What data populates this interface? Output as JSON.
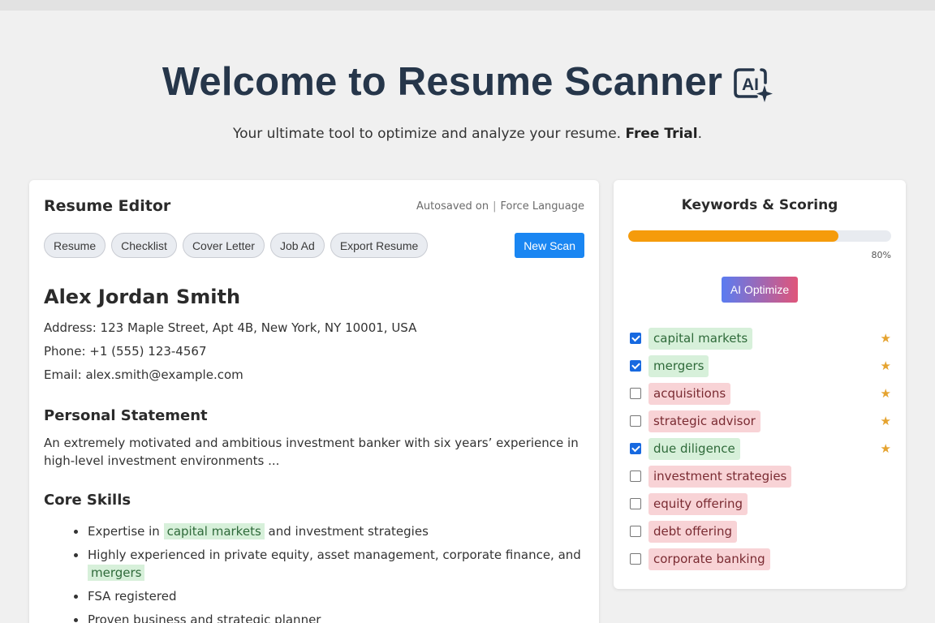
{
  "header": {
    "title": "Welcome to Resume Scanner",
    "subtitle_main": "Your ultimate tool to optimize and analyze your resume.",
    "subtitle_bold": "Free Trial",
    "subtitle_end": "."
  },
  "editor": {
    "title": "Resume Editor",
    "autosave": "Autosaved on",
    "force_language": "Force Language",
    "tabs": [
      "Resume",
      "Checklist",
      "Cover Letter",
      "Job Ad",
      "Export Resume"
    ],
    "new_scan_label": "New Scan",
    "resume": {
      "name": "Alex Jordan Smith",
      "address": "Address: 123 Maple Street, Apt 4B, New York, NY 10001, USA",
      "phone": "Phone: +1 (555) 123-4567",
      "email": "Email: alex.smith@example.com",
      "personal_statement_heading": "Personal Statement",
      "personal_statement": "An extremely motivated and ambitious investment banker with six years’ experience in high-level investment environments ...",
      "core_skills_heading": "Core Skills",
      "skills": [
        {
          "before": "Expertise in ",
          "keyword": "capital markets",
          "after": " and investment strategies"
        },
        {
          "before": "Highly experienced in private equity, asset management, corporate finance, and ",
          "keyword": "mergers",
          "after": ""
        },
        {
          "before": "FSA registered",
          "keyword": "",
          "after": ""
        },
        {
          "before": "Proven business and strategic planner",
          "keyword": "",
          "after": ""
        }
      ]
    }
  },
  "scoring": {
    "title": "Keywords & Scoring",
    "progress_percent": 80,
    "progress_text": "80%",
    "ai_optimize_label": "AI Optimize",
    "keywords": [
      {
        "label": "capital markets",
        "checked": true,
        "starred": true
      },
      {
        "label": "mergers",
        "checked": true,
        "starred": true
      },
      {
        "label": "acquisitions",
        "checked": false,
        "starred": true
      },
      {
        "label": "strategic advisor",
        "checked": false,
        "starred": true
      },
      {
        "label": "due diligence",
        "checked": true,
        "starred": true
      },
      {
        "label": "investment strategies",
        "checked": false,
        "starred": false
      },
      {
        "label": "equity offering",
        "checked": false,
        "starred": false
      },
      {
        "label": "debt offering",
        "checked": false,
        "starred": false
      },
      {
        "label": "corporate banking",
        "checked": false,
        "starred": false
      }
    ],
    "star_glyph": "★"
  },
  "colors": {
    "title": "#26364a",
    "accent_blue": "#1a86f2",
    "progress": "#f59b0b",
    "matched_bg": "#d7f0da",
    "missing_bg": "#f8d3d6",
    "star": "#e5a32f"
  },
  "icons": {
    "title_icon": "ai-sparkle-icon"
  }
}
